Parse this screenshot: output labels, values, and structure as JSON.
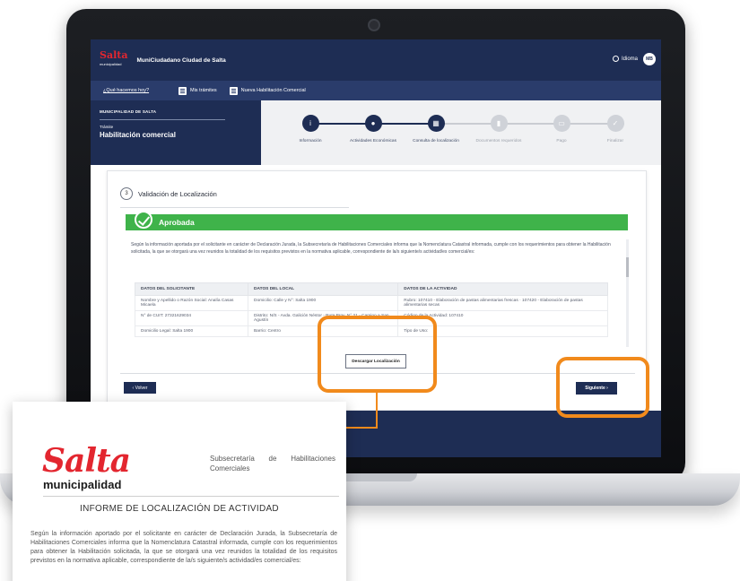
{
  "app": {
    "logo_text": "Salta",
    "logo_subtext": "municipalidad",
    "title": "MuniCiudadano Ciudad de Salta",
    "language_label": "Idioma",
    "avatar_initials": "MB"
  },
  "nav": {
    "question": "¿Qué hacemos hoy?",
    "items": [
      {
        "label": "Mis trámites",
        "icon": "list-icon"
      },
      {
        "label": "Nueva Habilitación Comercial",
        "icon": "list-icon"
      }
    ]
  },
  "tramite": {
    "breadcrumb": "MUNICIPALIDAD DE SALTA",
    "small_label": "Trámite",
    "title": "Habilitación comercial"
  },
  "steps": [
    {
      "label": "Información",
      "state": "done",
      "icon": "info"
    },
    {
      "label": "Actividades Económicas",
      "state": "done",
      "icon": "people"
    },
    {
      "label": "Consulta de localización",
      "state": "current",
      "icon": "map"
    },
    {
      "label": "Documentos requeridos",
      "state": "pending",
      "icon": "doc"
    },
    {
      "label": "Pago",
      "state": "pending",
      "icon": "card"
    },
    {
      "label": "Finalizar",
      "state": "pending",
      "icon": "check"
    }
  ],
  "section": {
    "number": "3",
    "title": "Validación de Localización"
  },
  "status": {
    "label": "Aprobada",
    "color": "#3fb34a"
  },
  "intro_text": "Según la información aportada por el solicitante en carácter de Declaración Jurada, la Subsecretaría de Habilitaciones Comerciales informa que la Nomenclatura Catastral informada, cumple con los requerimientos para obtener la Habilitación solicitada, la que se otorgará una vez reunidos la totalidad de los requisitos previstos en la normativa aplicable, correspondiente de la/s siguiente/s actividad/es comercial/es:",
  "table": {
    "headers": [
      "DATOS DEL SOLICITANTE",
      "DATOS DEL LOCAL",
      "DATOS DE LA ACTIVIDAD"
    ],
    "rows": [
      [
        "Nombre y Apellido o Razón Social: Analía Casas Micaela",
        "Domicilio: Calle y N°: Salta 1900",
        "Rubro: 107410 - Elaboración de pastas alimentarias frescas · 107420 - Elaboración de pastas alimentarias secas"
      ],
      [
        "N° de CUIT: 27321629034",
        "Distrito: N/S - Avda. Galición Néstor - Ruta Prov. N° 21 - Camino a San Agustín",
        "Código de la Actividad: 107410"
      ],
      [
        "Domicilio Legal: Salta 1900",
        "Barrio: Centro",
        "Tipo de Uso:"
      ]
    ]
  },
  "buttons": {
    "download": "Descargar Localización",
    "back": "‹  Volver",
    "next": "Siguiente  ›"
  },
  "report": {
    "logo_text": "Salta",
    "logo_subtext": "municipalidad",
    "header": "Subsecretaría de Habilitaciones Comerciales",
    "title": "INFORME DE LOCALIZACIÓN DE ACTIVIDAD",
    "body": "Según la información aportado por el solicitante en carácter de Declaración Jurada, la Subsecretaría de Habilitaciones Comerciales informa que la Nomenclatura Catastral informada, cumple con los requerimientos para obtener la Habilitación solicitada, la que se otorgará una vez reunidos la totalidad de los requisitos previstos en la normativa aplicable, correspondiente de la/s siguiente/s actividad/es comercial/es:"
  },
  "colors": {
    "navy": "#1e2d54",
    "highlight": "#f18a1c",
    "brand_red": "#e3262f"
  }
}
